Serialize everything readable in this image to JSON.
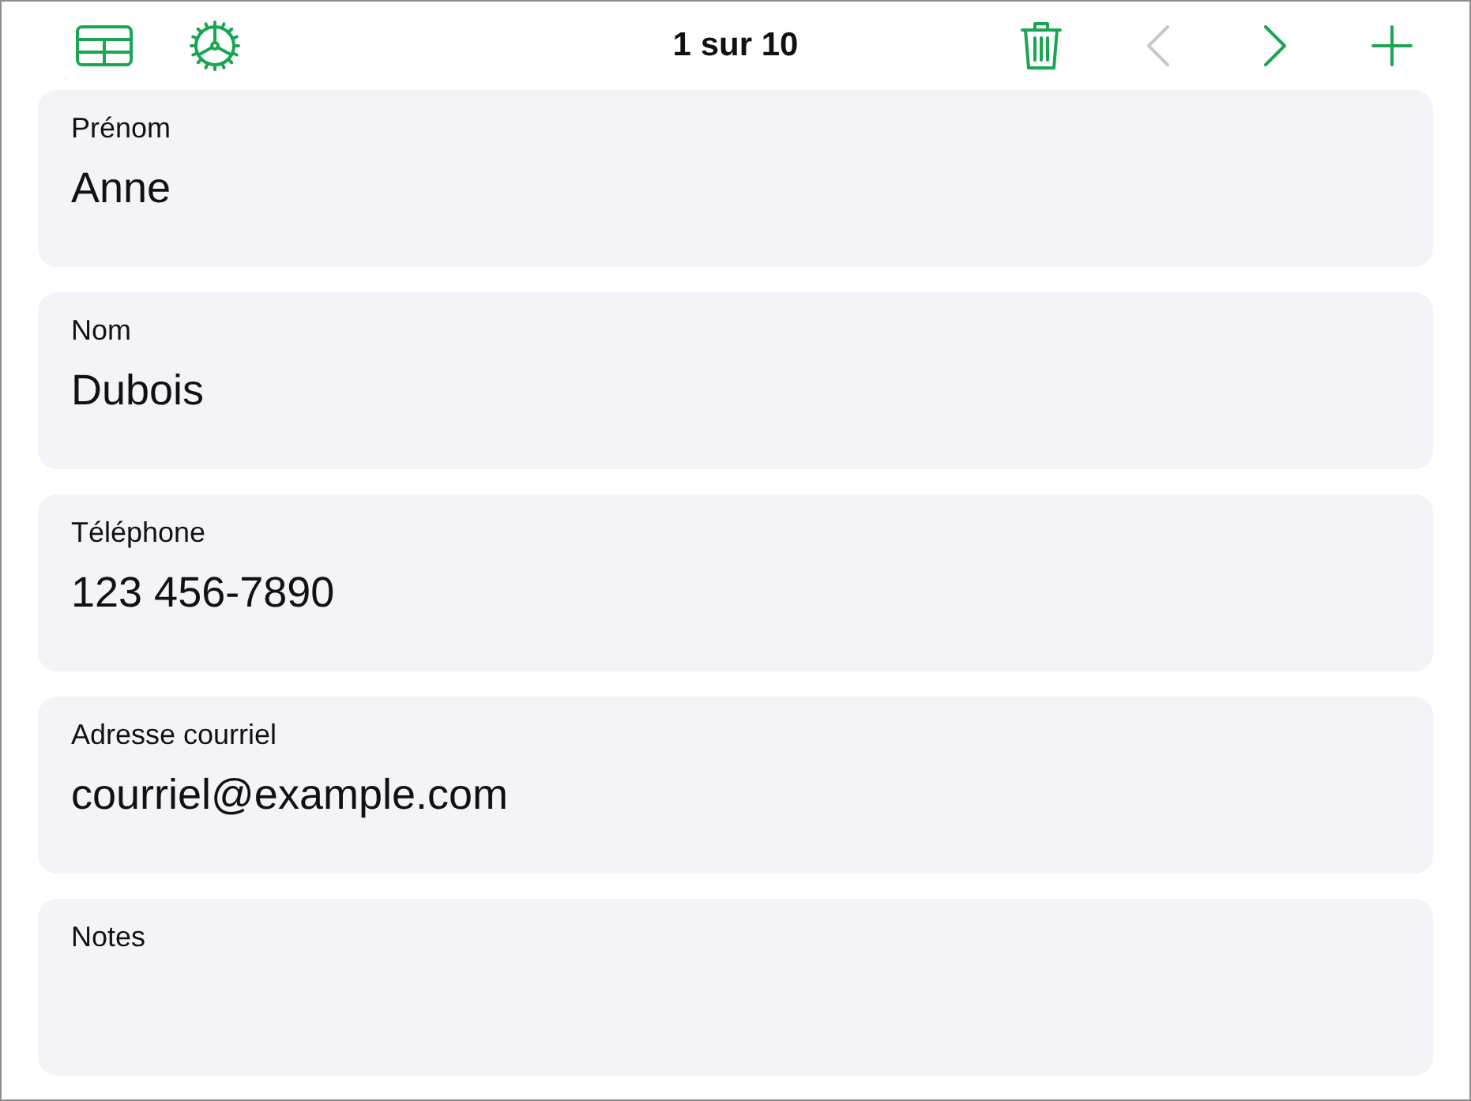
{
  "toolbar": {
    "record_position": "1 sur 10",
    "left_buttons": [
      {
        "kind": "table",
        "disabled": false
      },
      {
        "kind": "gear",
        "disabled": false
      }
    ],
    "right_buttons": [
      {
        "kind": "trash",
        "disabled": false
      },
      {
        "kind": "previous",
        "disabled": true
      },
      {
        "kind": "next",
        "disabled": false
      },
      {
        "kind": "add",
        "disabled": false
      }
    ]
  },
  "fields": [
    {
      "label": "Prénom",
      "value": "Anne"
    },
    {
      "label": "Nom",
      "value": "Dubois"
    },
    {
      "label": "Téléphone",
      "value": "123 456-7890"
    },
    {
      "label": "Adresse courriel",
      "value": "courriel@example.com"
    },
    {
      "label": "Notes"
    }
  ]
}
